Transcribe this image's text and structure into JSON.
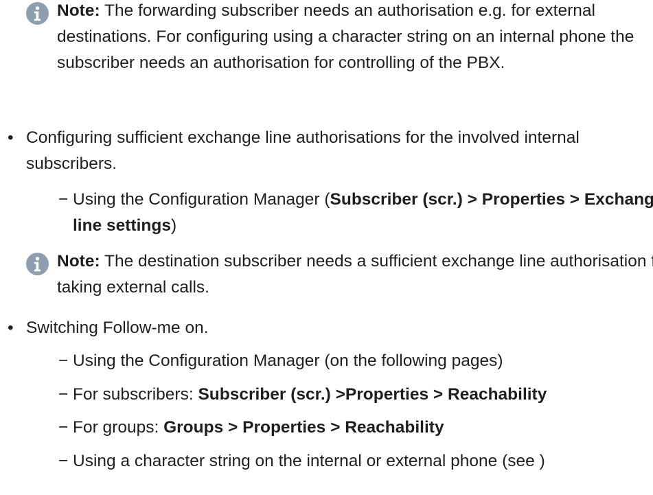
{
  "note_label": "Note:",
  "note1_text": " The forwarding subscriber needs an authorisation e.g. for external destinations. For configuring using a character string on an internal phone the subscriber needs an authorisation for controlling of the PBX.",
  "bullet_mark": "•",
  "dash_mark": "−",
  "bullet1_text": "Configuring sufficient exchange line authorisations for the involved internal subscribers.",
  "sub1_prefix": "Using the Configuration Manager (",
  "sub1_bold": "Subscriber (scr.) > Properties > Exchange line settings",
  "sub1_suffix": ")",
  "note2_text": " The destination subscriber needs a sufficient exchange line authorisation for taking external calls.",
  "bullet2_text": "Switching Follow-me on.",
  "sub2_text": "Using the Configuration Manager (on the following pages)",
  "sub3_prefix": "For subscribers: ",
  "sub3_bold": "Subscriber (scr.) >Properties > Reachability",
  "sub4_prefix": "For groups: ",
  "sub4_bold": "Groups > Properties > Reachability",
  "sub5_text": "Using a character string on the internal or external phone (see )",
  "colors": {
    "info_icon": "#8d9eaf",
    "text": "#1f1f1f"
  },
  "icons": {
    "note": "info-icon"
  }
}
